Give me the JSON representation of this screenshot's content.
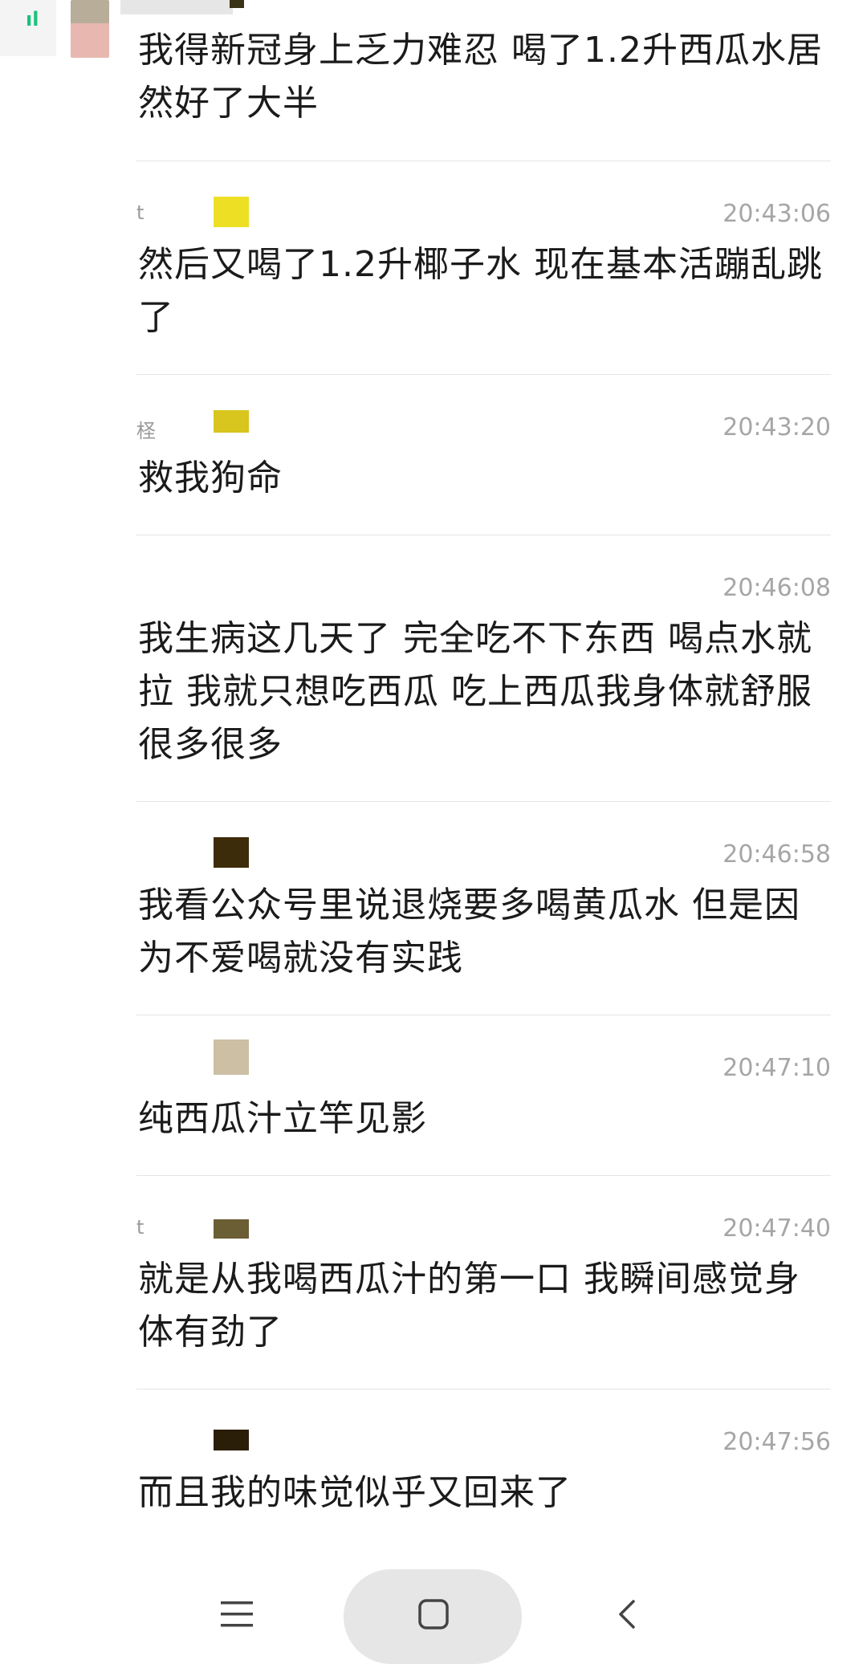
{
  "status": {
    "signal_icon": "signal-bars-icon"
  },
  "top_message": {
    "text": "我得新冠身上乏力难忍 喝了1.2升西瓜水居然好了大半"
  },
  "messages": [
    {
      "name": "t",
      "tag_color": "#ede024",
      "time": "20:43:06",
      "text": "然后又喝了1.2升椰子水 现在基本活蹦乱跳了"
    },
    {
      "name": "柽",
      "tag_color": "#d8c51e",
      "time": "20:43:20",
      "text": "救我狗命"
    },
    {
      "name": "",
      "tag_color": "",
      "time": "20:46:08",
      "text": "我生病这几天了 完全吃不下东西 喝点水就拉 我就只想吃西瓜 吃上西瓜我身体就舒服很多很多"
    },
    {
      "name": "",
      "tag_color": "#3d2c0a",
      "time": "20:46:58",
      "text": "我看公众号里说退烧要多喝黄瓜水 但是因为不爱喝就没有实践"
    },
    {
      "name": "",
      "tag_color": "#cdbfa4",
      "time": "20:47:10",
      "text": "纯西瓜汁立竿见影"
    },
    {
      "name": "t",
      "tag_color": "#6b5e35",
      "time": "20:47:40",
      "text": "就是从我喝西瓜汁的第一口 我瞬间感觉身体有劲了"
    },
    {
      "name": "",
      "tag_color": "#2b1e08",
      "time": "20:47:56",
      "text": "而且我的味觉似乎又回来了"
    }
  ],
  "nav": {
    "menu_icon": "menu-icon",
    "home_icon": "home-square-icon",
    "back_icon": "back-chevron-icon"
  }
}
